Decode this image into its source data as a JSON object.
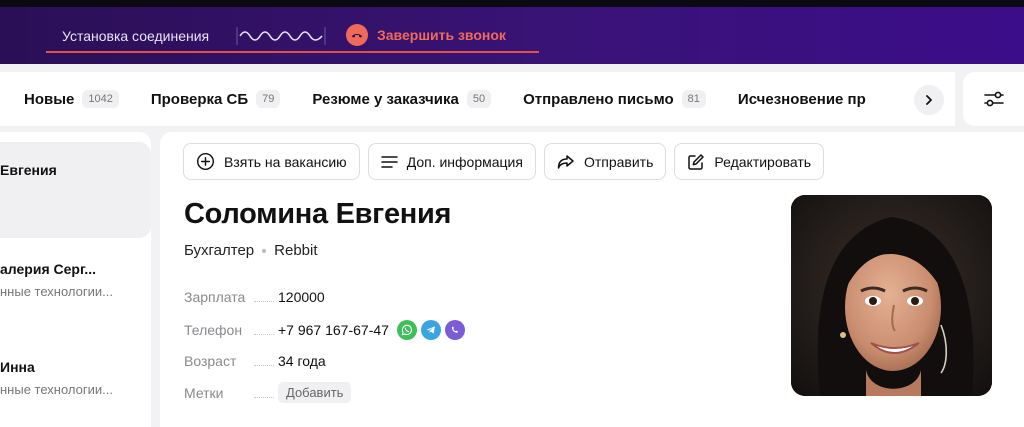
{
  "call": {
    "status": "Установка соединения",
    "end_label": "Завершить звонок",
    "accent": "#f06a5a"
  },
  "tabs": [
    {
      "label": "Новые",
      "count": "1042"
    },
    {
      "label": "Проверка СБ",
      "count": "79"
    },
    {
      "label": "Резюме у заказчика",
      "count": "50"
    },
    {
      "label": "Отправлено письмо",
      "count": "81"
    },
    {
      "label": "Исчезновение пр",
      "count": ""
    }
  ],
  "candidates": [
    {
      "name": "Евгения",
      "sub": ""
    },
    {
      "name": "алерия Серг...",
      "sub": "нные технологии..."
    },
    {
      "name": "Инна",
      "sub": "нные технологии..."
    }
  ],
  "actions": {
    "take": "Взять на вакансию",
    "info": "Доп. информация",
    "send": "Отправить",
    "edit": "Редактировать"
  },
  "profile": {
    "name": "Соломина Евгения",
    "position": "Бухгалтер",
    "company": "Rebbit",
    "fields": {
      "salary_label": "Зарплата",
      "salary": "120000",
      "phone_label": "Телефон",
      "phone": "+7 967 167-67-47",
      "age_label": "Возраст",
      "age": "34 года",
      "tags_label": "Метки",
      "tags_add": "Добавить"
    },
    "messengers": [
      "whatsapp-icon",
      "telegram-icon",
      "viber-icon"
    ]
  }
}
